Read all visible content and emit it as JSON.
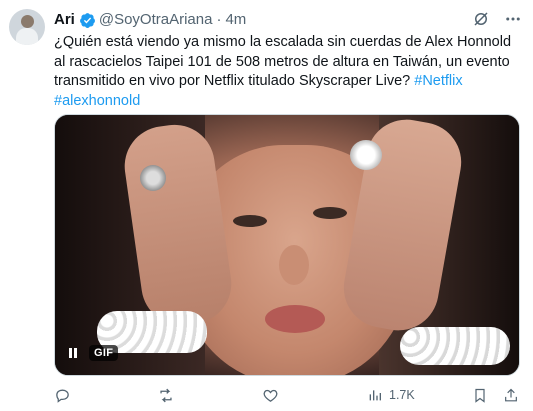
{
  "author": {
    "name": "Ari",
    "handle": "@SoyOtraAriana",
    "separator": "·",
    "time": "4m"
  },
  "tweet": {
    "body": "¿Quién está viendo ya mismo la escalada sin cuerdas de Alex Honnold al rascacielos Taipei 101 de 508 metros de altura en Taiwán, un evento transmitido en vivo por Netflix titulado Skyscraper Live?",
    "hashtags": [
      "#Netflix",
      "#alexhonnold"
    ]
  },
  "media": {
    "badge": "GIF",
    "icon": "pause-icon"
  },
  "actions": {
    "reply": {
      "icon": "reply-icon",
      "count": ""
    },
    "repost": {
      "icon": "repost-icon",
      "count": ""
    },
    "like": {
      "icon": "heart-icon",
      "count": ""
    },
    "views": {
      "icon": "views-icon",
      "count": "1.7K"
    },
    "bookmark": {
      "icon": "bookmark-icon"
    },
    "share": {
      "icon": "share-icon"
    }
  },
  "colors": {
    "accent": "#1d9bf0",
    "text": "#0f1419",
    "muted": "#536471"
  }
}
